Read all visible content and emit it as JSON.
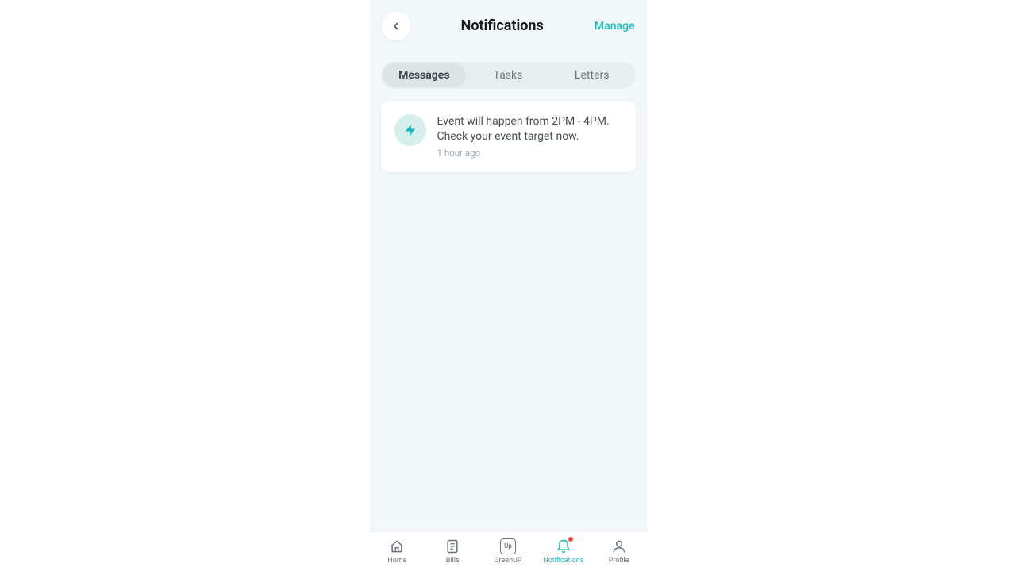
{
  "header": {
    "title": "Notifications",
    "manage_label": "Manage"
  },
  "tabs": [
    {
      "label": "Messages",
      "active": true
    },
    {
      "label": "Tasks",
      "active": false
    },
    {
      "label": "Letters",
      "active": false
    }
  ],
  "notifications": [
    {
      "icon": "flash-icon",
      "text": "Event will happen from 2PM - 4PM. Check your event target now.",
      "time": "1 hour ago"
    }
  ],
  "bottom_nav": [
    {
      "icon": "home-icon",
      "label": "Home",
      "active": false
    },
    {
      "icon": "bills-icon",
      "label": "Bills",
      "active": false
    },
    {
      "icon": "greenup-icon",
      "label": "GreenUP",
      "active": false
    },
    {
      "icon": "bell-icon",
      "label": "Notifications",
      "active": true,
      "badge": true
    },
    {
      "icon": "profile-icon",
      "label": "Profile",
      "active": false
    }
  ]
}
